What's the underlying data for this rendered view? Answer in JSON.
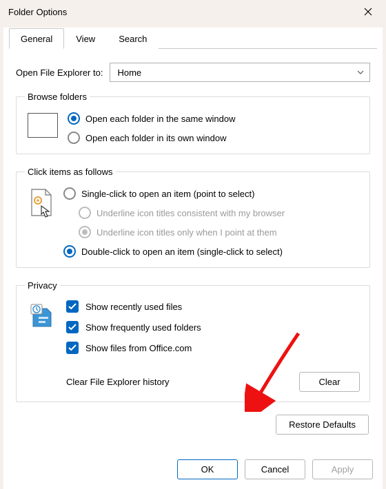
{
  "window": {
    "title": "Folder Options"
  },
  "tabs": [
    {
      "label": "General",
      "active": true
    },
    {
      "label": "View",
      "active": false
    },
    {
      "label": "Search",
      "active": false
    }
  ],
  "openExplorer": {
    "label": "Open File Explorer to:",
    "selected": "Home"
  },
  "browseFolders": {
    "legend": "Browse folders",
    "options": [
      {
        "label": "Open each folder in the same window",
        "checked": true
      },
      {
        "label": "Open each folder in its own window",
        "checked": false
      }
    ]
  },
  "clickItems": {
    "legend": "Click items as follows",
    "options": {
      "single": "Single-click to open an item (point to select)",
      "underlineBrowser": "Underline icon titles consistent with my browser",
      "underlinePoint": "Underline icon titles only when I point at them",
      "double": "Double-click to open an item (single-click to select)"
    }
  },
  "privacy": {
    "legend": "Privacy",
    "checks": [
      {
        "label": "Show recently used files",
        "checked": true
      },
      {
        "label": "Show frequently used folders",
        "checked": true
      },
      {
        "label": "Show files from Office.com",
        "checked": true
      }
    ],
    "clearLabel": "Clear File Explorer history",
    "clearButton": "Clear"
  },
  "buttons": {
    "restore": "Restore Defaults",
    "ok": "OK",
    "cancel": "Cancel",
    "apply": "Apply"
  }
}
